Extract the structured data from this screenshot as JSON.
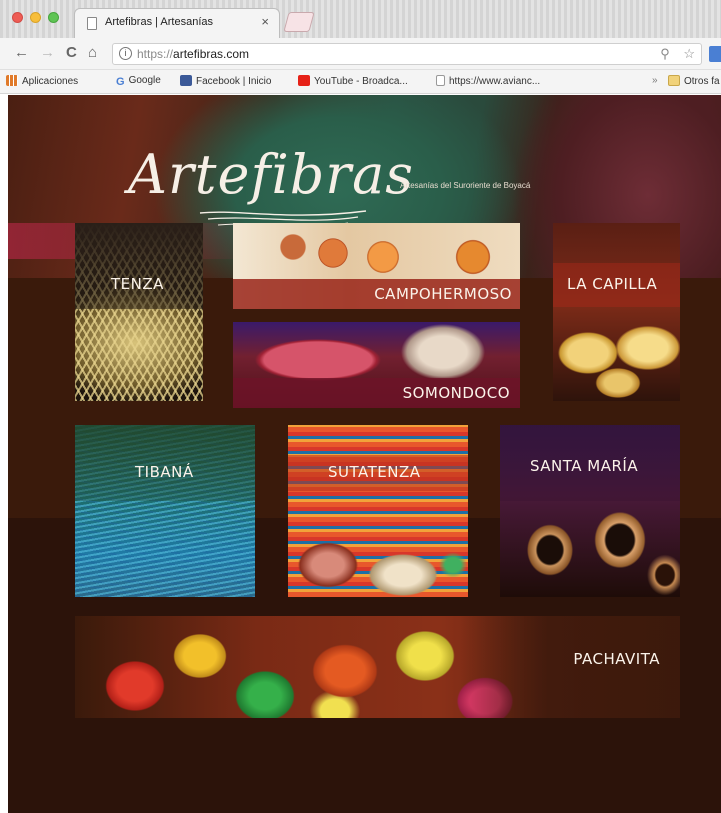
{
  "browser": {
    "tab_title": "Artefibras | Artesanías",
    "tab_close": "×",
    "url_scheme": "https://",
    "url_host": "artefibras.com",
    "back_icon": "←",
    "forward_icon": "→",
    "reload_icon": "C",
    "home_icon": "⌂",
    "zoom_icon": "⚲",
    "star_icon": "☆",
    "bookmarks": [
      {
        "label": "Aplicaciones",
        "icon": "apps-icon",
        "color": "#e07a2a"
      },
      {
        "label": "Google",
        "icon": "google-icon",
        "color": "#4a7fd3"
      },
      {
        "label": "Facebook | Inicio",
        "icon": "facebook-icon",
        "color": "#3b5998"
      },
      {
        "label": "YouTube - Broadca...",
        "icon": "youtube-icon",
        "color": "#e62117"
      },
      {
        "label": "https://www.avianc...",
        "icon": "page-icon",
        "color": "#ffffff"
      }
    ],
    "bookmarks_overflow": "»",
    "other_bookmarks": "Otros fa"
  },
  "hero": {
    "logo": "Artefibras",
    "tagline": "Artesanías del Suroriente de Boyacá"
  },
  "tiles": {
    "tenza": "TENZA",
    "campohermoso": "CAMPOHERMOSO",
    "la_capilla": "LA CAPILLA",
    "somondoco": "SOMONDOCO",
    "tibana": "TIBANÁ",
    "sutatenza": "SUTATENZA",
    "santa_maria": "SANTA MARÍA",
    "pachavita": "PACHAVITA"
  },
  "colors": {
    "page_bg": "#3a1a0b",
    "tile_label": "#fbf3ea",
    "label_bar": "#96201a"
  }
}
